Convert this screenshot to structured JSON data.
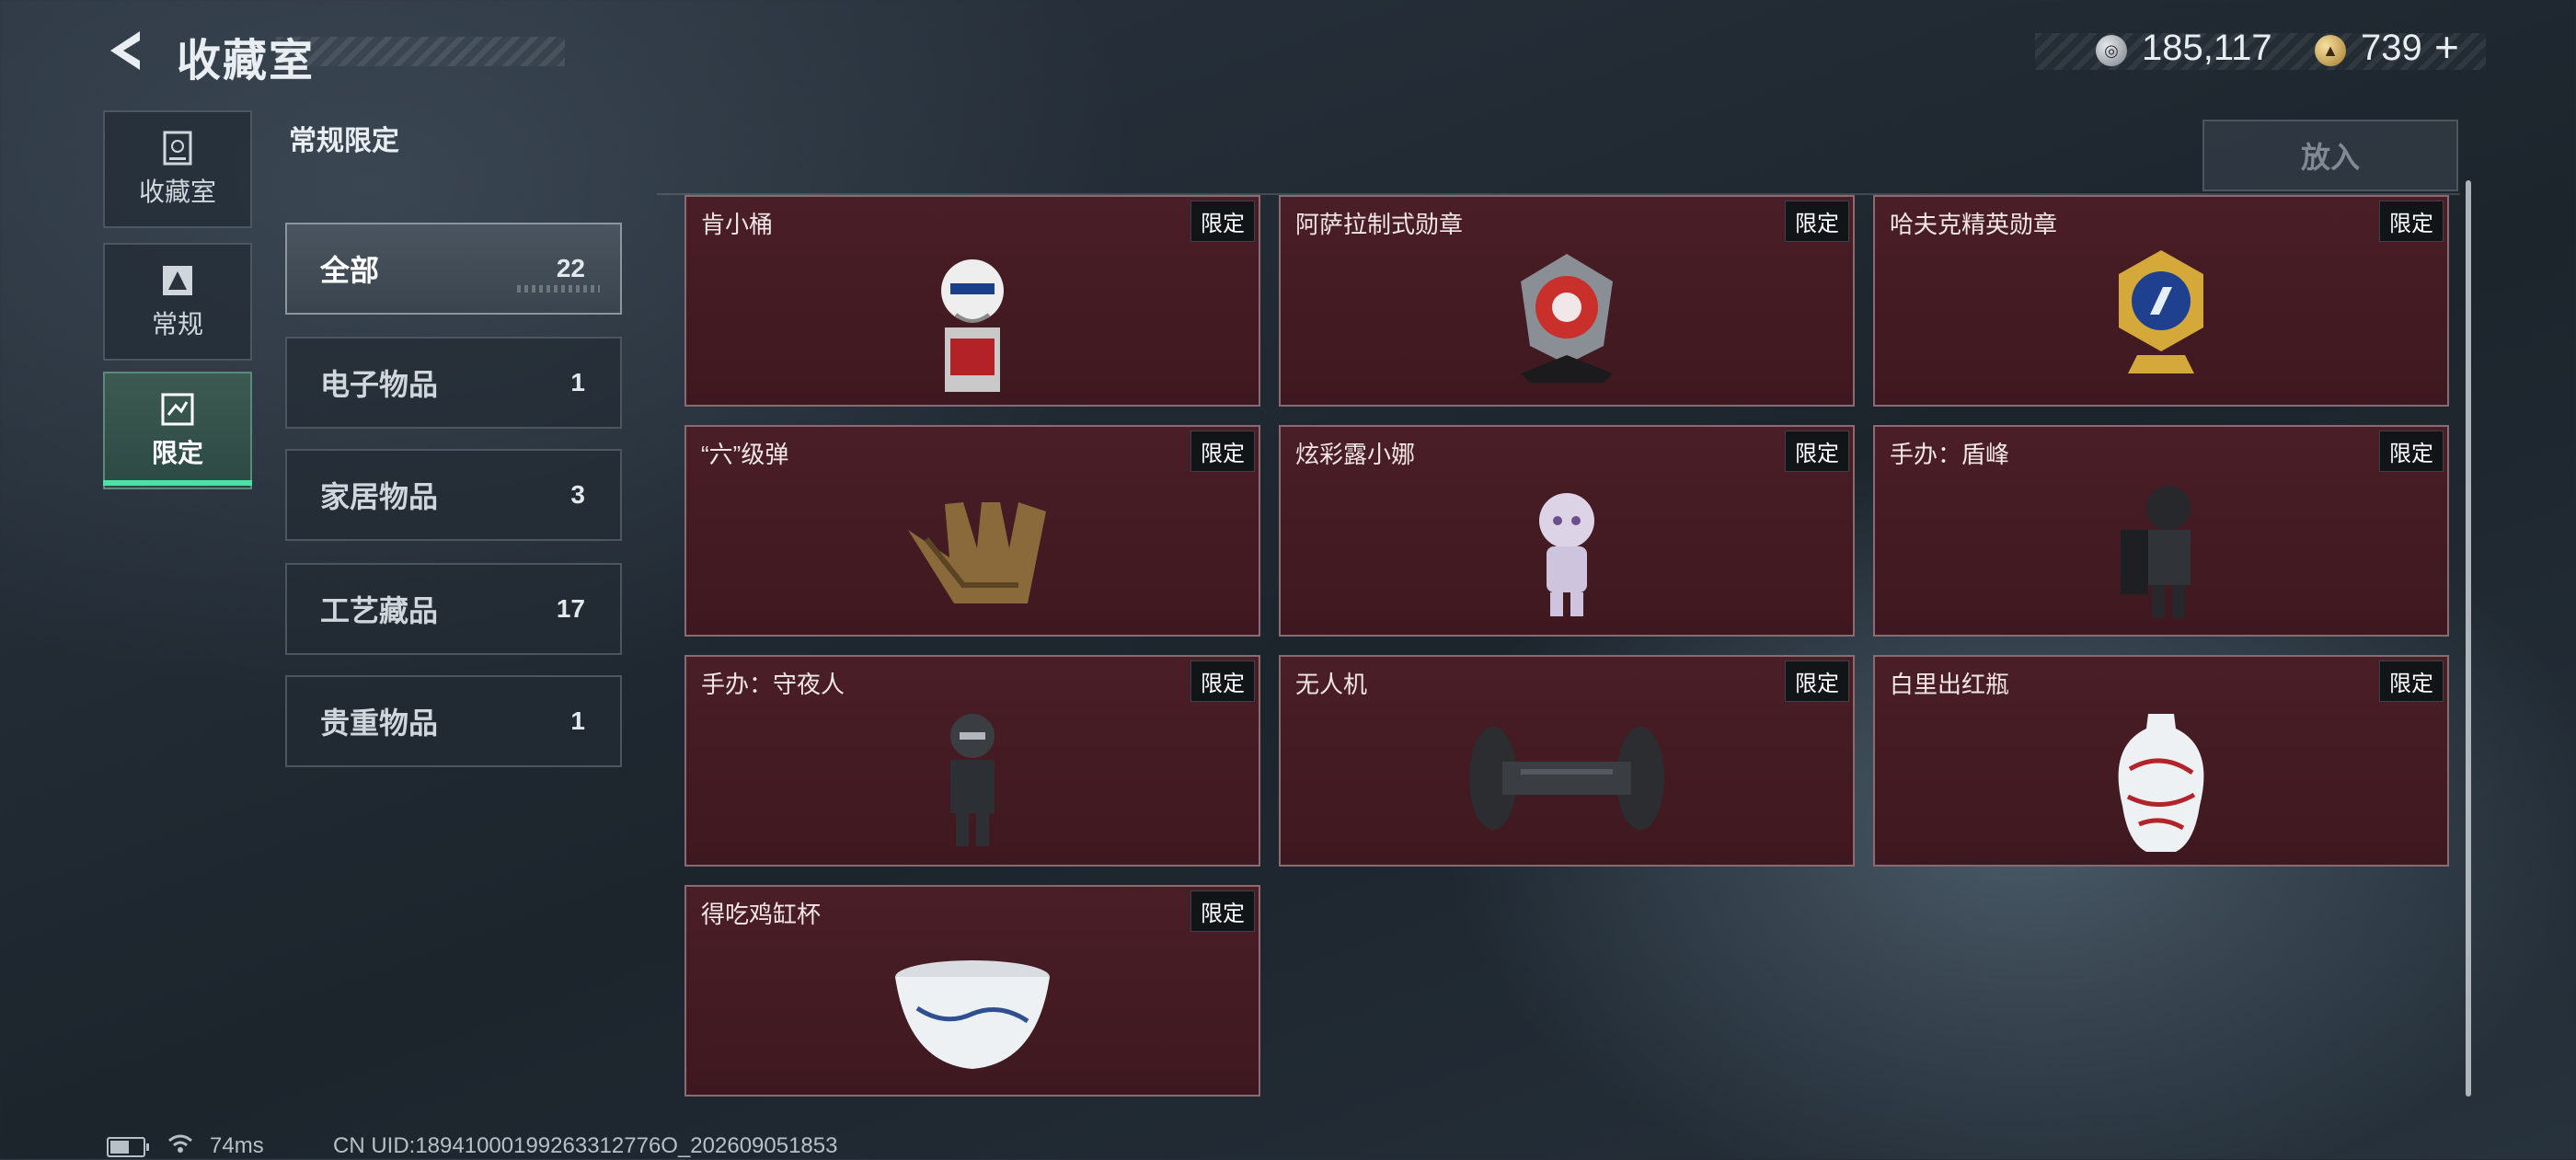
{
  "header": {
    "title": "收藏室"
  },
  "currency": {
    "silver_value": "185,117",
    "gold_value": "739",
    "add_label": "+"
  },
  "nav": [
    {
      "label": "收藏室",
      "icon": "vault-icon"
    },
    {
      "label": "常规",
      "icon": "regular-icon"
    },
    {
      "label": "限定",
      "icon": "limited-icon",
      "active": true
    }
  ],
  "section_title": "常规限定",
  "put_in_label": "放入",
  "categories": [
    {
      "name": "全部",
      "count": "22",
      "active": true
    },
    {
      "name": "电子物品",
      "count": "1"
    },
    {
      "name": "家居物品",
      "count": "3"
    },
    {
      "name": "工艺藏品",
      "count": "17"
    },
    {
      "name": "贵重物品",
      "count": "1"
    }
  ],
  "items": [
    {
      "name": "肯小桶",
      "tag": "限定",
      "icon": "colonel-bucket-figure-icon"
    },
    {
      "name": "阿萨拉制式勋章",
      "tag": "限定",
      "icon": "asara-medal-icon"
    },
    {
      "name": "哈夫克精英勋章",
      "tag": "限定",
      "icon": "haavk-elite-medal-icon"
    },
    {
      "name": "“六”级弹",
      "tag": "限定",
      "icon": "bullet-hand-icon"
    },
    {
      "name": "炫彩露小娜",
      "tag": "限定",
      "icon": "luna-figure-icon"
    },
    {
      "name": "手办：盾峰",
      "tag": "限定",
      "icon": "shield-figure-icon"
    },
    {
      "name": "手办：守夜人",
      "tag": "限定",
      "icon": "nightwatch-figure-icon"
    },
    {
      "name": "无人机",
      "tag": "限定",
      "icon": "drone-icon"
    },
    {
      "name": "白里出红瓶",
      "tag": "限定",
      "icon": "porcelain-vase-icon"
    },
    {
      "name": "得吃鸡缸杯",
      "tag": "限定",
      "icon": "porcelain-cup-icon"
    }
  ],
  "footer": {
    "ping": "74ms",
    "uid": "CN UID:18941000199263312776O_202609051853"
  },
  "colors": {
    "accent": "#4fe0a6",
    "card_bg": "#4a1e26",
    "card_border": "#8a6b72"
  }
}
